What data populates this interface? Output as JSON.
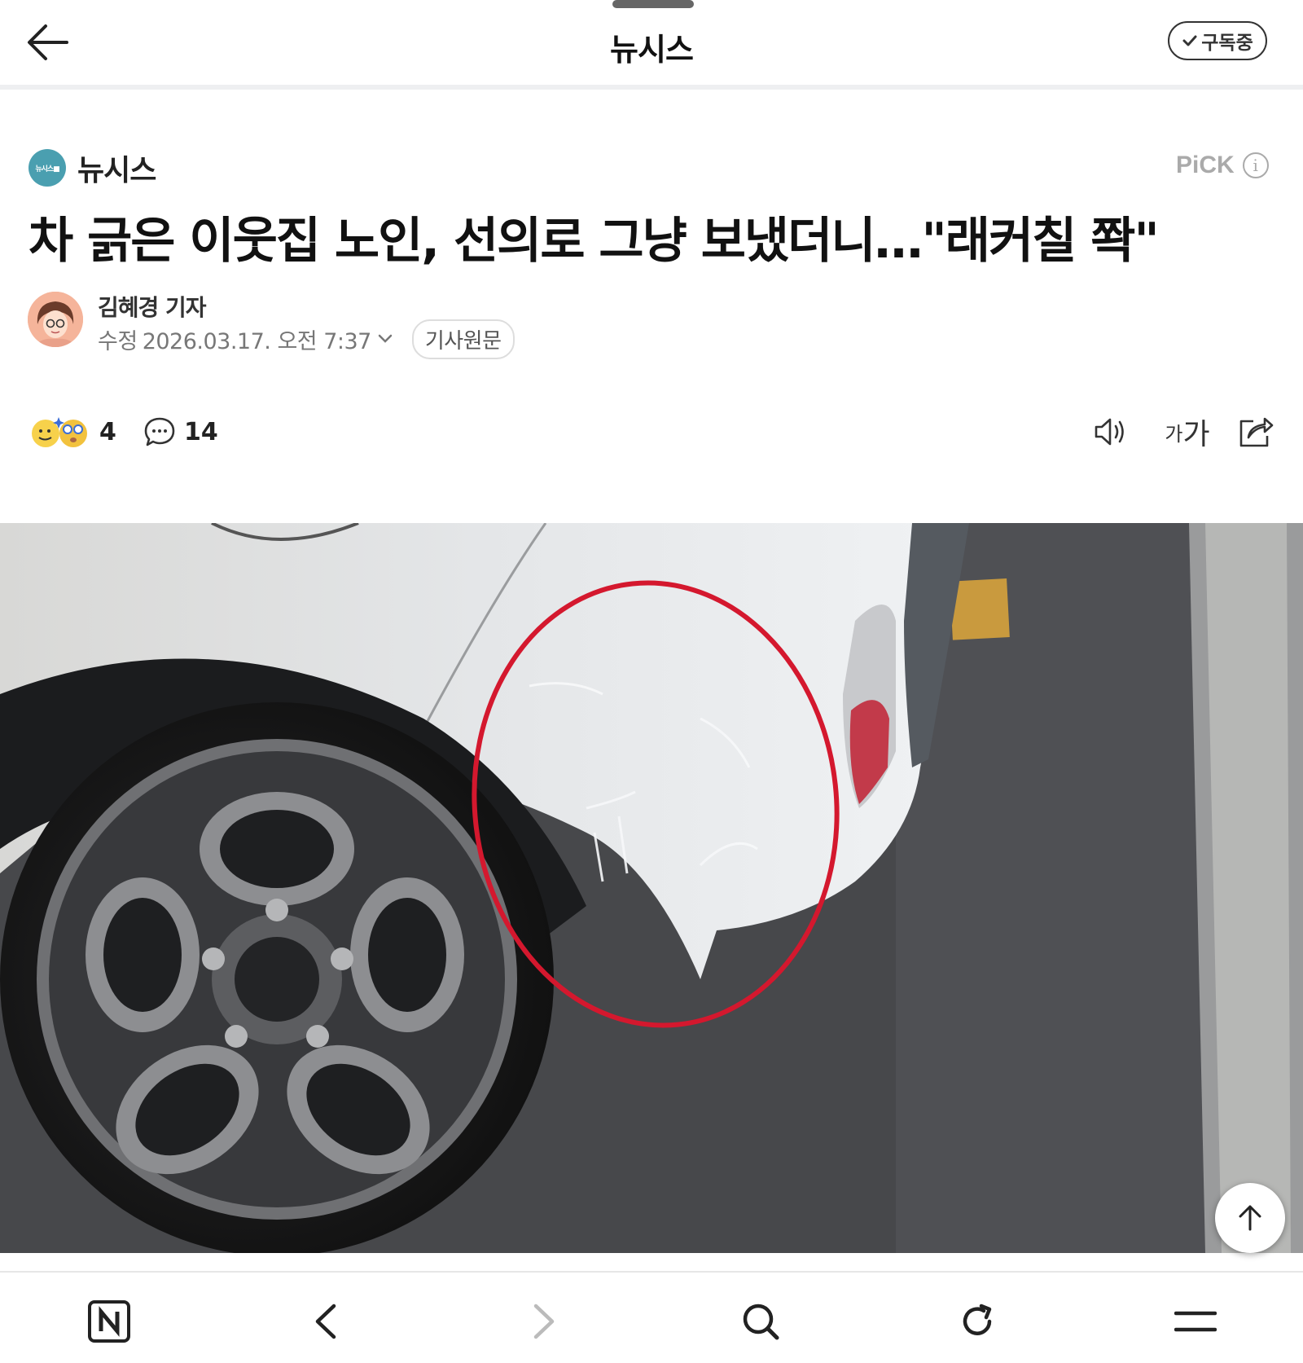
{
  "topbar": {
    "title": "뉴시스",
    "subscribe_label": "구독중"
  },
  "article": {
    "press_name": "뉴시스",
    "press_logo_text": "뉴시스■",
    "pick_label": "PiCK",
    "headline": "차 긁은 이웃집 노인, 선의로 그냥 보냈더니…\"래커칠 쫙\"",
    "reporter": "김혜경 기자",
    "modified_prefix": "수정",
    "modified_time": "2026.03.17. 오전 7:37",
    "original_link": "기사원문"
  },
  "actions": {
    "reaction_count": "4",
    "comment_count": "14",
    "font_small": "가",
    "font_big": "가"
  },
  "icons": [
    "back-arrow-icon",
    "checkmark-icon",
    "info-icon",
    "reaction-emoji-icon",
    "comment-bubble-icon",
    "speaker-icon",
    "share-icon",
    "arrow-up-icon",
    "naver-home-icon",
    "chevron-left-icon",
    "chevron-right-icon",
    "search-icon",
    "refresh-icon",
    "menu-icon"
  ],
  "colors": {
    "press_logo": "#4a9fb0",
    "highlight_circle": "#d4182e",
    "pick": "#aaaaaa"
  }
}
